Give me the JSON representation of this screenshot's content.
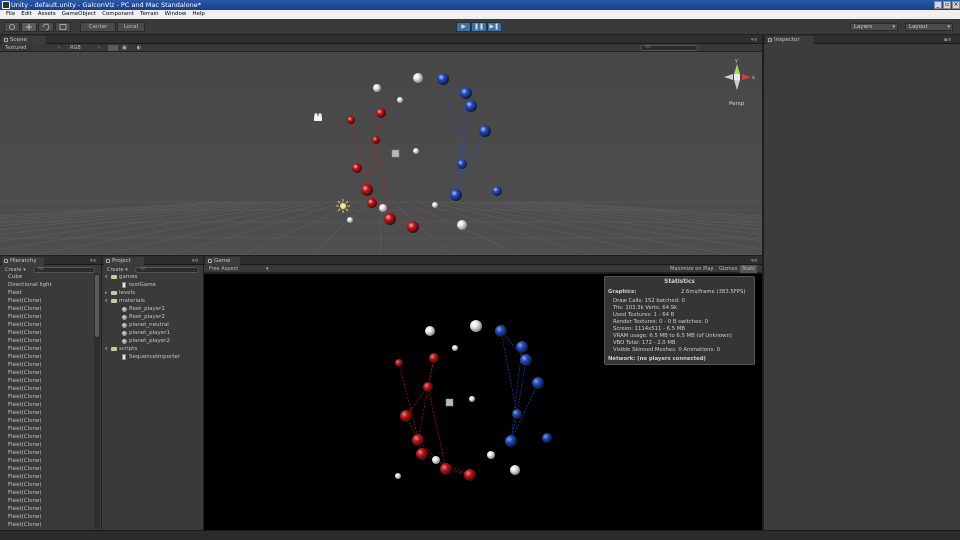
{
  "window": {
    "title": "Unity - default.unity - GalconViz - PC and Mac Standalone*",
    "controls": [
      "_",
      "▫",
      "×"
    ]
  },
  "menubar": {
    "items": [
      "File",
      "Edit",
      "Assets",
      "GameObject",
      "Component",
      "Terrain",
      "Window",
      "Help"
    ]
  },
  "toolbar": {
    "tools": [
      "hand-tool",
      "move-tool",
      "rotate-tool",
      "scale-tool"
    ],
    "pivot_label": "Center",
    "space_label": "Local",
    "play_controls": [
      "▶",
      "❚❚",
      "▶❚"
    ],
    "layers_label": "Layers",
    "layout_label": "Layout"
  },
  "scene": {
    "tab_label": "Scene",
    "render_mode": "Textured",
    "color_mode": "RGB",
    "search_placeholder": "All",
    "gizmo_label": "Persp",
    "gizmo_axes": [
      "y",
      "x"
    ]
  },
  "inspector": {
    "tab_label": "Inspector"
  },
  "hierarchy": {
    "tab_label": "Hierarchy",
    "create_label": "Create",
    "search_placeholder": "All",
    "items": [
      "Cube",
      "Directional light",
      "Fleet",
      "Fleet(Clone)",
      "Fleet(Clone)",
      "Fleet(Clone)",
      "Fleet(Clone)",
      "Fleet(Clone)",
      "Fleet(Clone)",
      "Fleet(Clone)",
      "Fleet(Clone)",
      "Fleet(Clone)",
      "Fleet(Clone)",
      "Fleet(Clone)",
      "Fleet(Clone)",
      "Fleet(Clone)",
      "Fleet(Clone)",
      "Fleet(Clone)",
      "Fleet(Clone)",
      "Fleet(Clone)",
      "Fleet(Clone)",
      "Fleet(Clone)",
      "Fleet(Clone)",
      "Fleet(Clone)",
      "Fleet(Clone)",
      "Fleet(Clone)",
      "Fleet(Clone)",
      "Fleet(Clone)",
      "Fleet(Clone)",
      "Fleet(Clone)",
      "Fleet(Clone)",
      "Fleet(Clone)"
    ]
  },
  "project": {
    "tab_label": "Project",
    "create_label": "Create",
    "search_placeholder": "All",
    "items": [
      {
        "label": "games",
        "kind": "folder",
        "depth": 0,
        "open": true
      },
      {
        "label": "testGame",
        "kind": "scene",
        "depth": 1
      },
      {
        "label": "levels",
        "kind": "folder",
        "depth": 0,
        "open": false
      },
      {
        "label": "materials",
        "kind": "folder",
        "depth": 0,
        "open": true
      },
      {
        "label": "fleet_player1",
        "kind": "material",
        "depth": 1
      },
      {
        "label": "fleet_player2",
        "kind": "material",
        "depth": 1
      },
      {
        "label": "planet_neutral",
        "kind": "material",
        "depth": 1
      },
      {
        "label": "planet_player1",
        "kind": "material",
        "depth": 1
      },
      {
        "label": "planet_player2",
        "kind": "material",
        "depth": 1
      },
      {
        "label": "scripts",
        "kind": "folder",
        "depth": 0,
        "open": true
      },
      {
        "label": "SequenceImporter",
        "kind": "script",
        "depth": 1
      }
    ]
  },
  "game": {
    "tab_label": "Game",
    "aspect_label": "Free Aspect",
    "maximize_label": "Maximize on Play",
    "gizmos_label": "Gizmos",
    "stats_label": "Stats"
  },
  "statistics": {
    "title": "Statistics",
    "graphics_label": "Graphics:",
    "frame_time": "2.6ms/frame (383.5FPS)",
    "lines": [
      "Draw Calls: 152   batched: 0",
      "Tris: 103.3k     Verts: 64.9k",
      "Used Textures: 1 - 64 B",
      "Render Textures: 0 - 0 B  switches: 0",
      "Screen: 1114x511 - 6.5 MB",
      "VRAM usage: 6.5 MB to 6.5 MB (of Unknown)",
      "VBO Total: 172 - 2.0 MB",
      "Visible Skinned Meshes: 0      Animations: 0"
    ],
    "network": "Network: (no players connected)"
  },
  "colors": {
    "player1": "#e01010",
    "player2": "#1f4fe0",
    "neutral": "#f0f0f0",
    "title_bar": "#2a57a8",
    "scene_bg": "#4b4b4b",
    "game_bg": "#000000"
  }
}
